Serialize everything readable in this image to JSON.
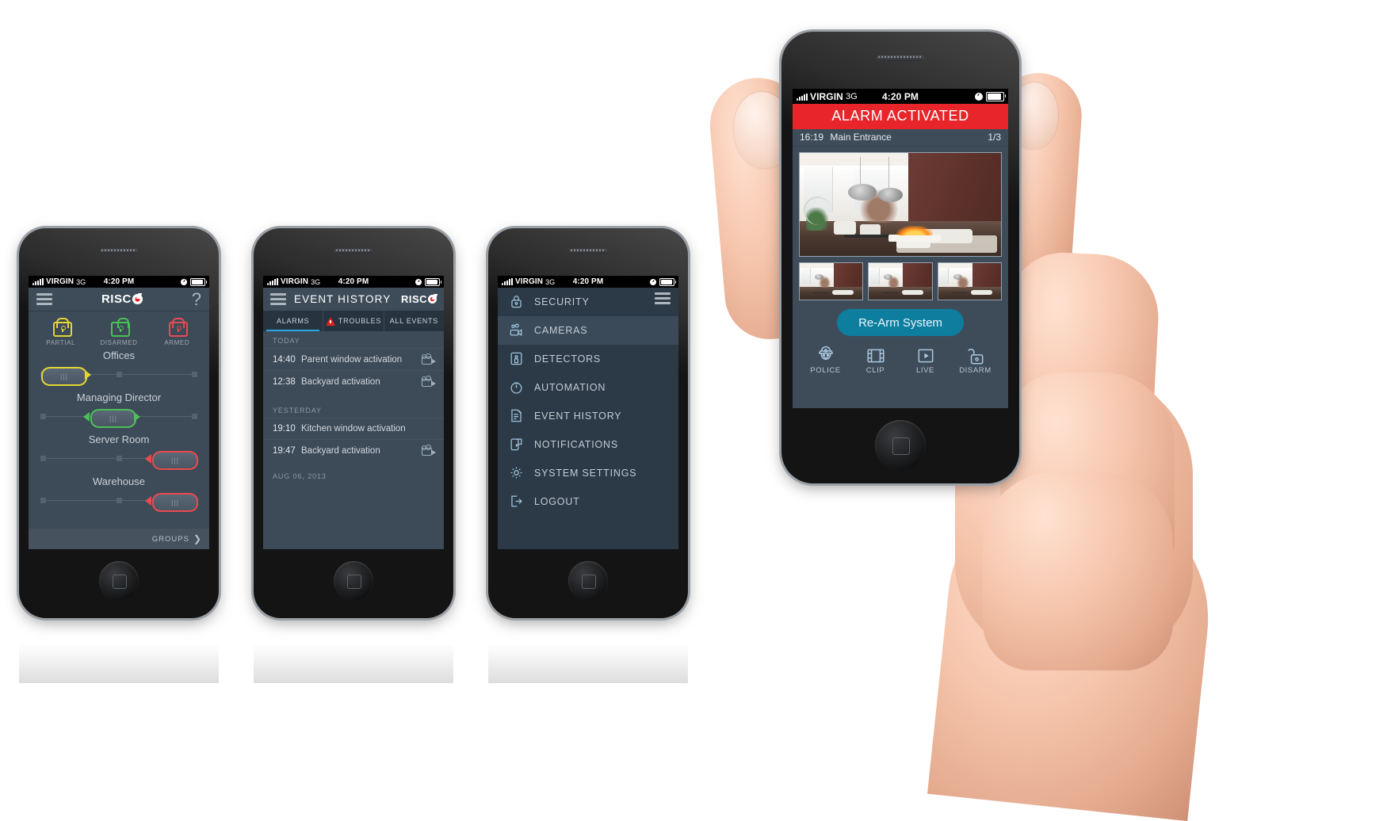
{
  "status_bar": {
    "carrier": "VIRGIN",
    "network": "3G",
    "time": "4:20 PM",
    "lock_icon": "rotation-lock-icon",
    "battery_icon": "battery-icon"
  },
  "phone_security": {
    "name": "security-panel-phone",
    "menu_icon": "hamburger-menu-icon",
    "brand": "RISC",
    "brand_mark": "risco-logo-o-icon",
    "help_label": "?",
    "modes": [
      {
        "label": "PARTIAL",
        "state": "partial",
        "color": "#e3d437",
        "icon": "padlock-closed-icon"
      },
      {
        "label": "DISARMED",
        "state": "disarmed",
        "color": "#4cbf5a",
        "icon": "padlock-open-icon"
      },
      {
        "label": "ARMED",
        "state": "armed",
        "color": "#e84a52",
        "icon": "padlock-closed-icon"
      }
    ],
    "zones": [
      {
        "name": "Offices",
        "position": "left",
        "color": "#e3d437",
        "arrows": "right",
        "grip": "|||"
      },
      {
        "name": "Managing Director",
        "position": "center",
        "color": "#4cbf5a",
        "arrows": "both",
        "grip": "|||"
      },
      {
        "name": "Server Room",
        "position": "right",
        "color": "#e84a52",
        "arrows": "left",
        "grip": "|||"
      },
      {
        "name": "Warehouse",
        "position": "right",
        "color": "#e84a52",
        "arrows": "left",
        "grip": "|||"
      }
    ],
    "footer_label": "GROUPS",
    "footer_chevron": "chevron-right-icon"
  },
  "phone_events": {
    "name": "event-history-phone",
    "menu_icon": "hamburger-menu-icon",
    "title": "EVENT HISTORY",
    "brand": "RISC",
    "tabs": [
      {
        "label": "ALARMS",
        "active": true,
        "icon": null
      },
      {
        "label": "TROUBLES",
        "active": false,
        "icon": "warning-triangle-icon"
      },
      {
        "label": "ALL EVENTS",
        "active": false,
        "icon": null
      }
    ],
    "groups": [
      {
        "label": "TODAY",
        "events": [
          {
            "time": "14:40",
            "description": "Parent window activation",
            "camera": true
          },
          {
            "time": "12:38",
            "description": "Backyard activation",
            "camera": true
          }
        ]
      },
      {
        "label": "YESTERDAY",
        "events": [
          {
            "time": "19:10",
            "description": "Kitchen window activation",
            "camera": false
          },
          {
            "time": "19:47",
            "description": "Backyard activation",
            "camera": true
          }
        ]
      },
      {
        "label": "AUG 06, 2013",
        "events": []
      }
    ]
  },
  "phone_menu": {
    "name": "main-menu-phone",
    "menu_icon": "hamburger-menu-icon",
    "items": [
      {
        "label": "SECURITY",
        "icon": "padlock-icon",
        "active": false
      },
      {
        "label": "CAMERAS",
        "icon": "video-camera-icon",
        "active": true
      },
      {
        "label": "DETECTORS",
        "icon": "detector-icon",
        "active": false
      },
      {
        "label": "AUTOMATION",
        "icon": "timer-icon",
        "active": false
      },
      {
        "label": "EVENT HISTORY",
        "icon": "document-pen-icon",
        "active": false
      },
      {
        "label": "NOTIFICATIONS",
        "icon": "phone-message-icon",
        "active": false
      },
      {
        "label": "SYSTEM SETTINGS",
        "icon": "gear-icon",
        "active": false
      },
      {
        "label": "LOGOUT",
        "icon": "logout-arrow-icon",
        "active": false
      }
    ]
  },
  "phone_alarm": {
    "name": "alarm-activated-phone",
    "banner": "ALARM ACTIVATED",
    "banner_color": "#e8252a",
    "event_time": "16:19",
    "event_location": "Main Entrance",
    "counter": "1/3",
    "main_camera_alt": "living-room-camera-view",
    "thumbnails": [
      "camera-thumbnail-1",
      "camera-thumbnail-2",
      "camera-thumbnail-3"
    ],
    "primary_button": {
      "label": "Re-Arm System",
      "color": "#0e7e9e"
    },
    "actions": [
      {
        "label": "POLICE",
        "icon": "police-officer-icon"
      },
      {
        "label": "CLIP",
        "icon": "film-clip-icon"
      },
      {
        "label": "LIVE",
        "icon": "play-icon"
      },
      {
        "label": "DISARM",
        "icon": "padlock-open-icon"
      }
    ]
  }
}
